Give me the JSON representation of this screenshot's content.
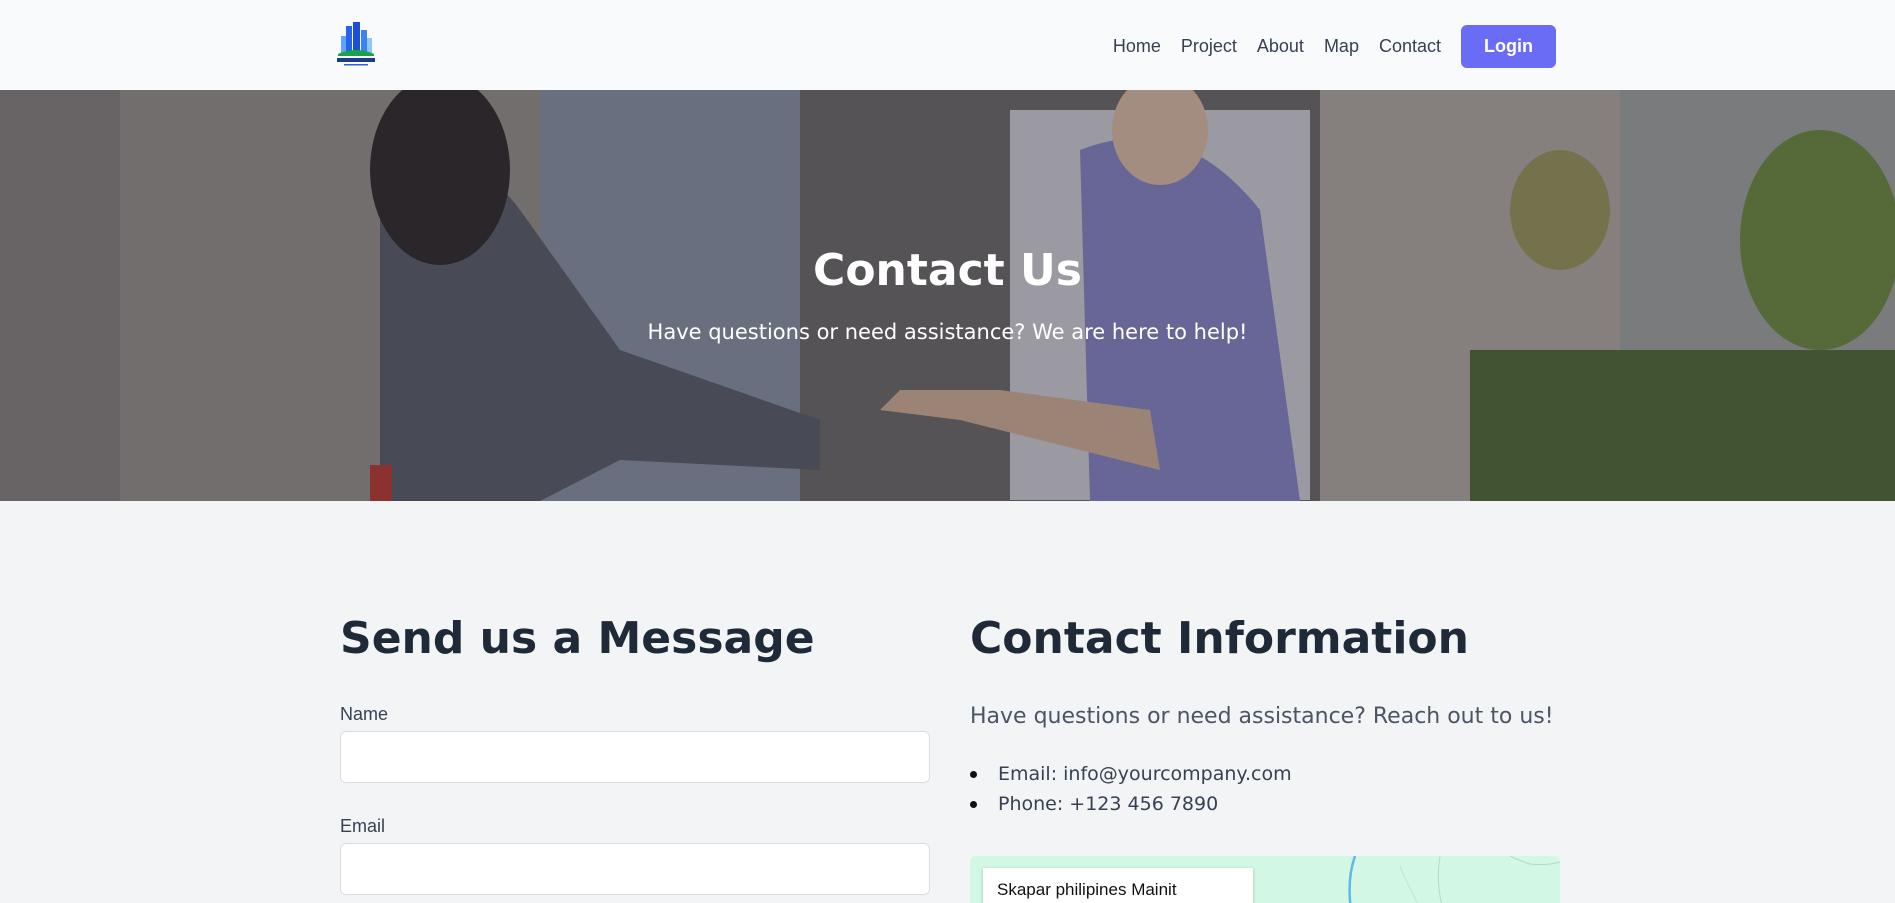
{
  "header": {
    "logo_icon": "building-logo-icon",
    "nav": [
      {
        "label": "Home"
      },
      {
        "label": "Project"
      },
      {
        "label": "About"
      },
      {
        "label": "Map"
      },
      {
        "label": "Contact"
      }
    ],
    "login_label": "Login",
    "accent_color": "#6a6cf6"
  },
  "hero": {
    "title": "Contact Us",
    "subtitle": "Have questions or need assistance? We are here to help!"
  },
  "form": {
    "heading": "Send us a Message",
    "name_label": "Name",
    "email_label": "Email"
  },
  "contact_info": {
    "heading": "Contact Information",
    "intro": "Have questions or need assistance? Reach out to us!",
    "items": [
      {
        "text": "Email: info@yourcompany.com"
      },
      {
        "text": "Phone: +123 456 7890"
      }
    ]
  },
  "map": {
    "place_name": "Skapar philipines Mainit"
  }
}
